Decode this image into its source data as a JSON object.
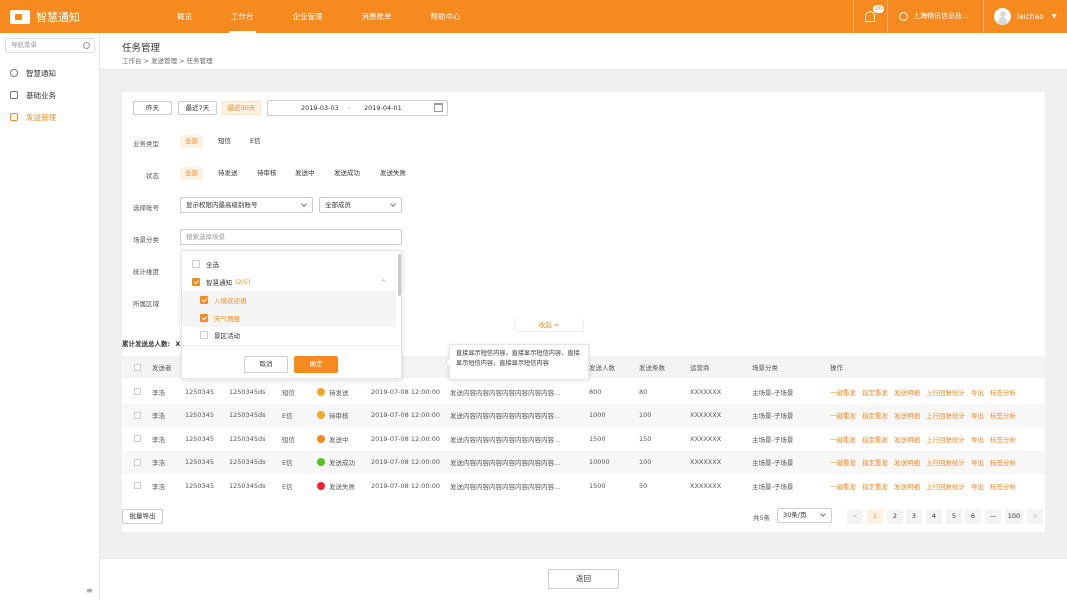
{
  "brand": {
    "name": "智慧通知"
  },
  "nav": [
    "概览",
    "工作台",
    "企业管理",
    "消费账单",
    "帮助中心"
  ],
  "nav_active": "工作台",
  "notifications": {
    "count": "26"
  },
  "company": "上海畅讯信息技...",
  "user": {
    "name": "laichao"
  },
  "sidebar": {
    "search_placeholder": "导航菜单",
    "items": [
      "智慧通知",
      "基础业务",
      "发送管理"
    ],
    "active": "发送管理"
  },
  "page": {
    "title": "任务管理",
    "breadcrumb": "工作台 > 发送管理 > 任务管理"
  },
  "date_filters": [
    "昨天",
    "最近7天",
    "最近30天"
  ],
  "date_active": "最近30天",
  "date_range": {
    "start": "2019-03-03",
    "sep": "~",
    "end": "2019-04-01"
  },
  "filters": {
    "business_type": {
      "label": "业务类型",
      "options": [
        "全部",
        "短信",
        "E信"
      ],
      "active": "全部"
    },
    "status": {
      "label": "状态",
      "options": [
        "全部",
        "待发送",
        "待审核",
        "发送中",
        "发送成功",
        "发送失败"
      ],
      "active": "全部"
    },
    "account": {
      "label": "选择账号",
      "select1": "显示权限内最高级别账号",
      "select2": "全部成员"
    },
    "scene": {
      "label": "场景分类",
      "placeholder": "搜索选择场景"
    },
    "stats_dim": {
      "label": "统计维度"
    },
    "region": {
      "label": "所属区域"
    }
  },
  "dropdown": {
    "select_all": "全选",
    "group": "智慧通知",
    "group_count": "(2/5)",
    "items": [
      {
        "label": "入境欢迎语",
        "checked": true
      },
      {
        "label": "天气预报",
        "checked": true
      },
      {
        "label": "景区活动",
        "checked": false
      }
    ],
    "cancel": "取消",
    "confirm": "确定"
  },
  "collapse_link": "收起 ≈",
  "summary": {
    "label": "累计发送总人数:",
    "value": "X"
  },
  "tooltip": "直接显示短信内容，直接显示短信内容，直接显示短信内容，直接显示短信内容",
  "table": {
    "headers": [
      "发送者",
      "",
      "",
      "",
      "",
      "",
      "",
      "发送人数",
      "发送条数",
      "运营商",
      "场景分类",
      "操作"
    ],
    "status_colors": {
      "待发送": "#f5a623",
      "待审核": "#f5a623",
      "发送中": "#f68a1e",
      "发送成功": "#52c41a",
      "发送失败": "#f5222d"
    },
    "rows": [
      {
        "sender": "李浩",
        "id": "1250345",
        "acct": "1250345ds",
        "type": "短信",
        "status": "待发送",
        "time": "2019-07-08 12:00:00",
        "content": "发送内容内容内容内容内容内容内容...",
        "people": "800",
        "count": "80",
        "carrier": "XXXXXXX",
        "scene": "主场景-子场景"
      },
      {
        "sender": "李浩",
        "id": "1250345",
        "acct": "1250345ds",
        "type": "E信",
        "status": "待审核",
        "time": "2019-07-08 12:00:00",
        "content": "发送内容内容内容内容内容内容内容...",
        "people": "1000",
        "count": "100",
        "carrier": "XXXXXXX",
        "scene": "主场景-子场景"
      },
      {
        "sender": "李浩",
        "id": "1250345",
        "acct": "1250345ds",
        "type": "短信",
        "status": "发送中",
        "time": "2019-07-08 12:00:00",
        "content": "发送内容内容内容内容内容内容内容...",
        "people": "1500",
        "count": "150",
        "carrier": "XXXXXXX",
        "scene": "主场景-子场景"
      },
      {
        "sender": "李浩",
        "id": "1250345",
        "acct": "1250345ds",
        "type": "E信",
        "status": "发送成功",
        "time": "2019-07-08 12:00:00",
        "content": "发送内容内容内容内容内容内容内容...",
        "people": "10000",
        "count": "100",
        "carrier": "XXXXXXX",
        "scene": "主场景-子场景"
      },
      {
        "sender": "李浩",
        "id": "1250345",
        "acct": "1250345ds",
        "type": "E信",
        "status": "发送失败",
        "time": "2019-07-08 12:00:00",
        "content": "发送内容内容内容内容内容内容内容...",
        "people": "1500",
        "count": "50",
        "carrier": "XXXXXXX",
        "scene": "主场景-子场景"
      }
    ],
    "ops": [
      "一键重发",
      "指定重发",
      "发送明细",
      "上行回复统计",
      "导出",
      "标签分析"
    ]
  },
  "bulk_export": "批量导出",
  "pagination": {
    "total": "共5条",
    "page_size": "30条/页",
    "pages": [
      "1",
      "2",
      "3",
      "4",
      "5",
      "6",
      "—",
      "100"
    ],
    "current": "1",
    "prev": "<",
    "next": ">"
  },
  "footer": {
    "back": "返回"
  },
  "colors": {
    "accent": "#f68a1e"
  }
}
